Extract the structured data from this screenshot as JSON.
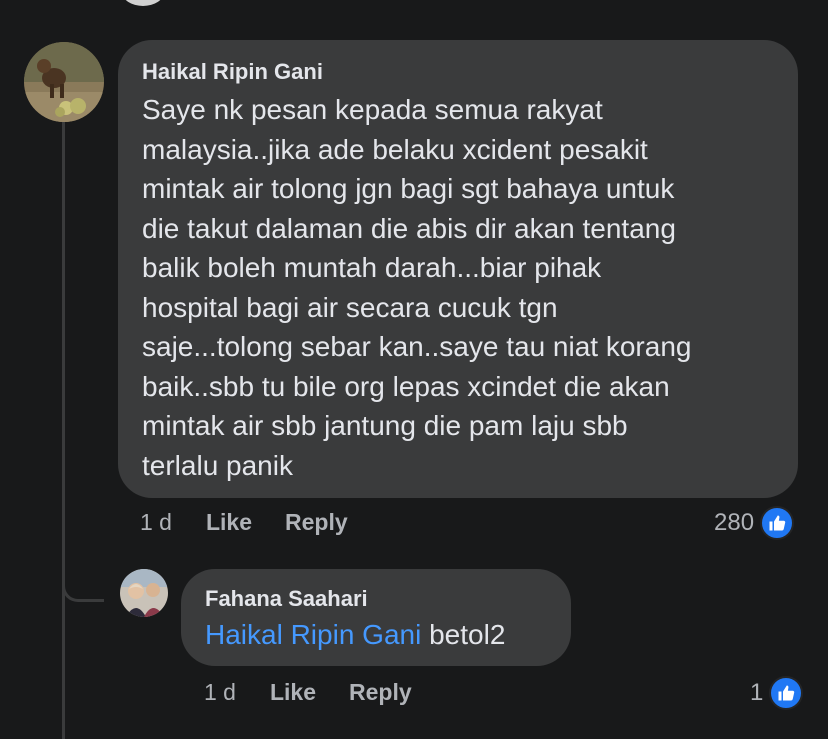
{
  "colors": {
    "background": "#18191a",
    "bubble": "#3a3b3c",
    "text": "#e4e6eb",
    "meta_text": "#b0b3b8",
    "mention": "#4599ff",
    "like_badge": "#2078f4"
  },
  "comment": {
    "author": "Haikal Ripin Gani",
    "lines": [
      "Saye nk pesan kepada semua rakyat",
      "malaysia..jika ade belaku xcident pesakit",
      "mintak air tolong jgn bagi sgt bahaya untuk",
      "die takut dalaman die abis dir akan tentang",
      "balik boleh muntah darah...biar pihak",
      "hospital bagi air secara cucuk tgn",
      "saje...tolong sebar kan..saye tau niat korang",
      "baik..sbb tu bile org lepas xcindet die akan",
      "mintak air sbb jantung die pam laju sbb",
      "terlalu panik"
    ],
    "time": "1 d",
    "like_label": "Like",
    "reply_label": "Reply",
    "reaction_count": "280",
    "reaction_icon": "thumbs-up-icon"
  },
  "reply": {
    "author": "Fahana Saahari",
    "mention": "Haikal Ripin Gani",
    "text": " betol2",
    "time": "1 d",
    "like_label": "Like",
    "reply_label": "Reply",
    "reaction_count": "1",
    "reaction_icon": "thumbs-up-icon"
  }
}
